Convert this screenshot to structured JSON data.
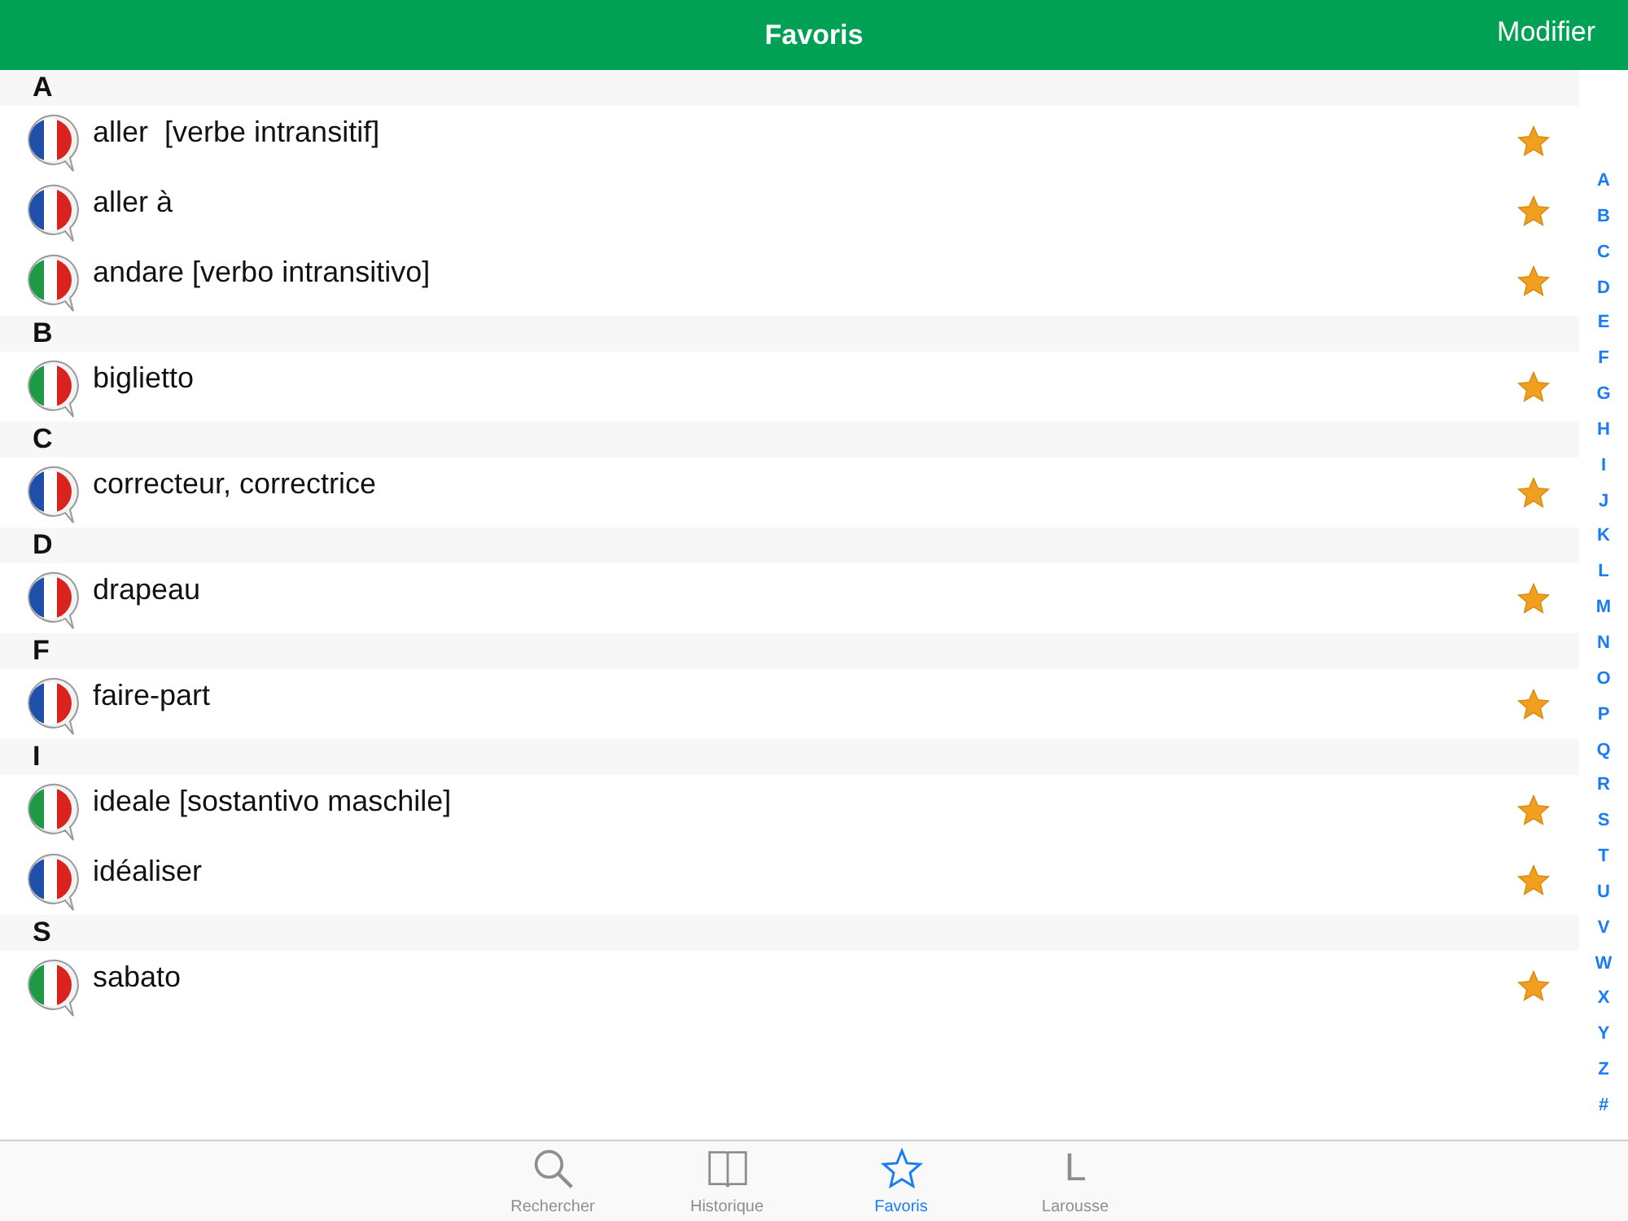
{
  "nav_bar": {
    "title": "Favoris",
    "edit_button": "Modifier"
  },
  "sections": [
    {
      "letter": "A",
      "rows": [
        {
          "text": "aller  [verbe intransitif]",
          "kind": "fr"
        },
        {
          "text": "aller à",
          "kind": "fr"
        },
        {
          "text": "andare [verbo intransitivo]",
          "kind": "it"
        }
      ]
    },
    {
      "letter": "B",
      "rows": [
        {
          "text": "biglietto",
          "kind": "it"
        }
      ]
    },
    {
      "letter": "C",
      "rows": [
        {
          "text": "correcteur, correctrice",
          "kind": "fr"
        }
      ]
    },
    {
      "letter": "D",
      "rows": [
        {
          "text": "drapeau",
          "kind": "fr"
        }
      ]
    },
    {
      "letter": "F",
      "rows": [
        {
          "text": "faire-part",
          "kind": "fr"
        }
      ]
    },
    {
      "letter": "I",
      "rows": [
        {
          "text": "ideale [sostantivo maschile]",
          "kind": "it"
        },
        {
          "text": "idéaliser",
          "kind": "fr"
        }
      ]
    },
    {
      "letter": "S",
      "rows": [
        {
          "text": "sabato",
          "kind": "it"
        }
      ]
    }
  ],
  "index": [
    "A",
    "B",
    "C",
    "D",
    "E",
    "F",
    "G",
    "H",
    "I",
    "J",
    "K",
    "L",
    "M",
    "N",
    "O",
    "P",
    "Q",
    "R",
    "S",
    "T",
    "U",
    "V",
    "W",
    "X",
    "Y",
    "Z",
    "#"
  ],
  "tab_bar": [
    {
      "label": "Rechercher",
      "kind": "search",
      "selected": false
    },
    {
      "label": "Historique",
      "kind": "book",
      "selected": false
    },
    {
      "label": "Favoris",
      "kind": "star",
      "selected": true
    },
    {
      "label": "Larousse",
      "kind": "letter",
      "icon_letter": "L",
      "selected": false
    }
  ]
}
